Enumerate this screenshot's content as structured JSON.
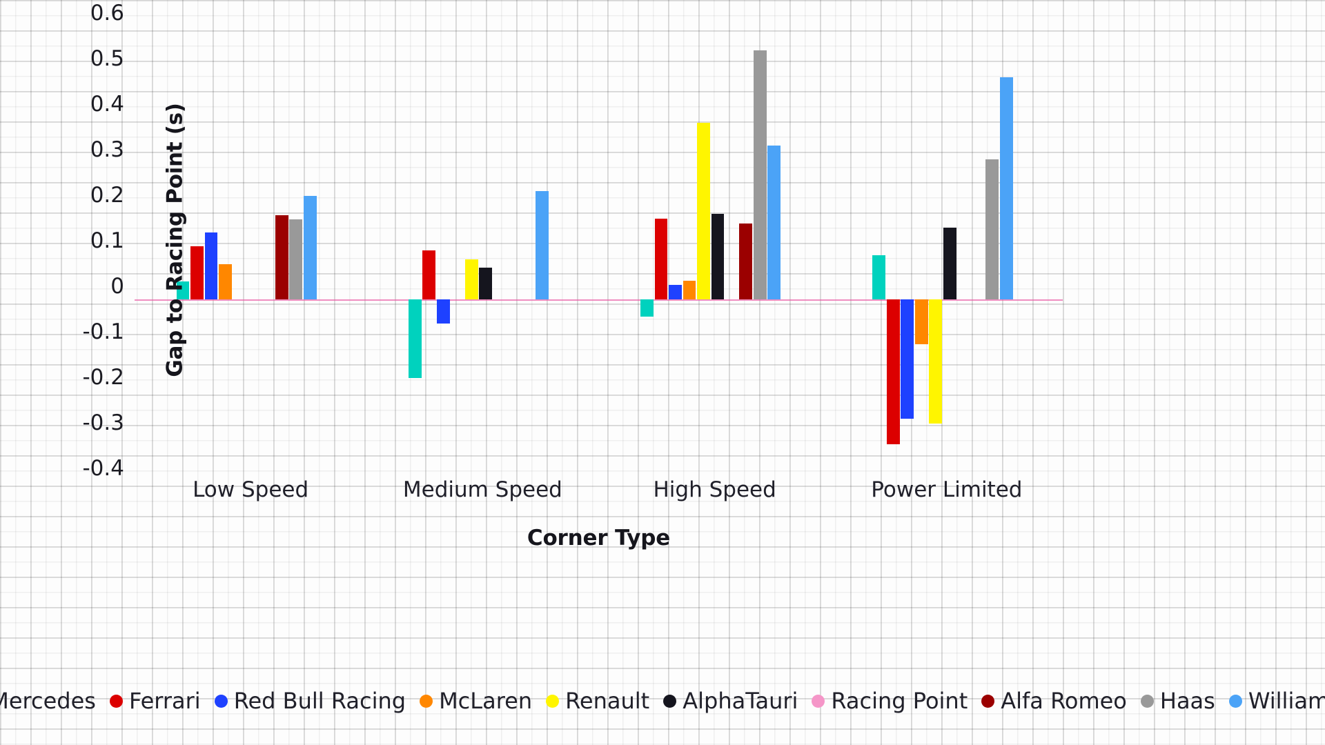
{
  "axes": {
    "ylabel": "Gap to Racing Point (s)",
    "xlabel": "Corner Type",
    "yticks": [
      "0.6",
      "0.5",
      "0.4",
      "0.3",
      "0.2",
      "0.1",
      "0",
      "-0.1",
      "-0.2",
      "-0.3",
      "-0.4"
    ],
    "ytick_values": [
      0.6,
      0.5,
      0.4,
      0.3,
      0.2,
      0.1,
      0,
      -0.1,
      -0.2,
      -0.3,
      -0.4
    ]
  },
  "legend": {
    "position": "bottom",
    "items": [
      {
        "label": "Mercedes",
        "color": "#00D2BE"
      },
      {
        "label": "Ferrari",
        "color": "#DC0000"
      },
      {
        "label": "Red Bull Racing",
        "color": "#1E41FF"
      },
      {
        "label": "McLaren",
        "color": "#FF8700"
      },
      {
        "label": "Renault",
        "color": "#FFF500"
      },
      {
        "label": "AlphaTauri",
        "color": "#15151E"
      },
      {
        "label": "Racing Point",
        "color": "#F596C8"
      },
      {
        "label": "Alfa Romeo",
        "color": "#9B0000"
      },
      {
        "label": "Haas",
        "color": "#999999"
      },
      {
        "label": "Williams",
        "color": "#4BA3F7"
      }
    ]
  },
  "chart_data": {
    "type": "bar",
    "title": "",
    "xlabel": "Corner Type",
    "ylabel": "Gap to Racing Point (s)",
    "ylim": [
      -0.4,
      0.6
    ],
    "grid": true,
    "categories": [
      "Low Speed",
      "Medium Speed",
      "High Speed",
      "Power Limited"
    ],
    "reference_line": 0,
    "series": [
      {
        "name": "Mercedes",
        "color": "#00D2BE",
        "values": [
          0.012,
          -0.2,
          -0.065,
          0.07
        ]
      },
      {
        "name": "Ferrari",
        "color": "#DC0000",
        "values": [
          0.09,
          0.08,
          0.15,
          -0.345
        ]
      },
      {
        "name": "Red Bull Racing",
        "color": "#1E41FF",
        "values": [
          0.12,
          -0.08,
          0.005,
          -0.29
        ]
      },
      {
        "name": "McLaren",
        "color": "#FF8700",
        "values": [
          0.05,
          -0.015,
          0.013,
          -0.125
        ]
      },
      {
        "name": "Renault",
        "color": "#FFF500",
        "values": [
          0.0,
          0.06,
          0.36,
          -0.3
        ]
      },
      {
        "name": "AlphaTauri",
        "color": "#15151E",
        "values": [
          -0.015,
          0.043,
          0.16,
          0.13
        ]
      },
      {
        "name": "Racing Point",
        "color": "#F596C8",
        "values": [
          0.0,
          0.0,
          0.0,
          0.0
        ]
      },
      {
        "name": "Alfa Romeo",
        "color": "#9B0000",
        "values": [
          0.157,
          -0.013,
          0.14,
          -0.01
        ]
      },
      {
        "name": "Haas",
        "color": "#999999",
        "values": [
          0.148,
          0.0,
          0.52,
          0.28
        ]
      },
      {
        "name": "Williams",
        "color": "#4BA3F7",
        "values": [
          0.2,
          0.21,
          0.31,
          0.46
        ]
      }
    ]
  }
}
